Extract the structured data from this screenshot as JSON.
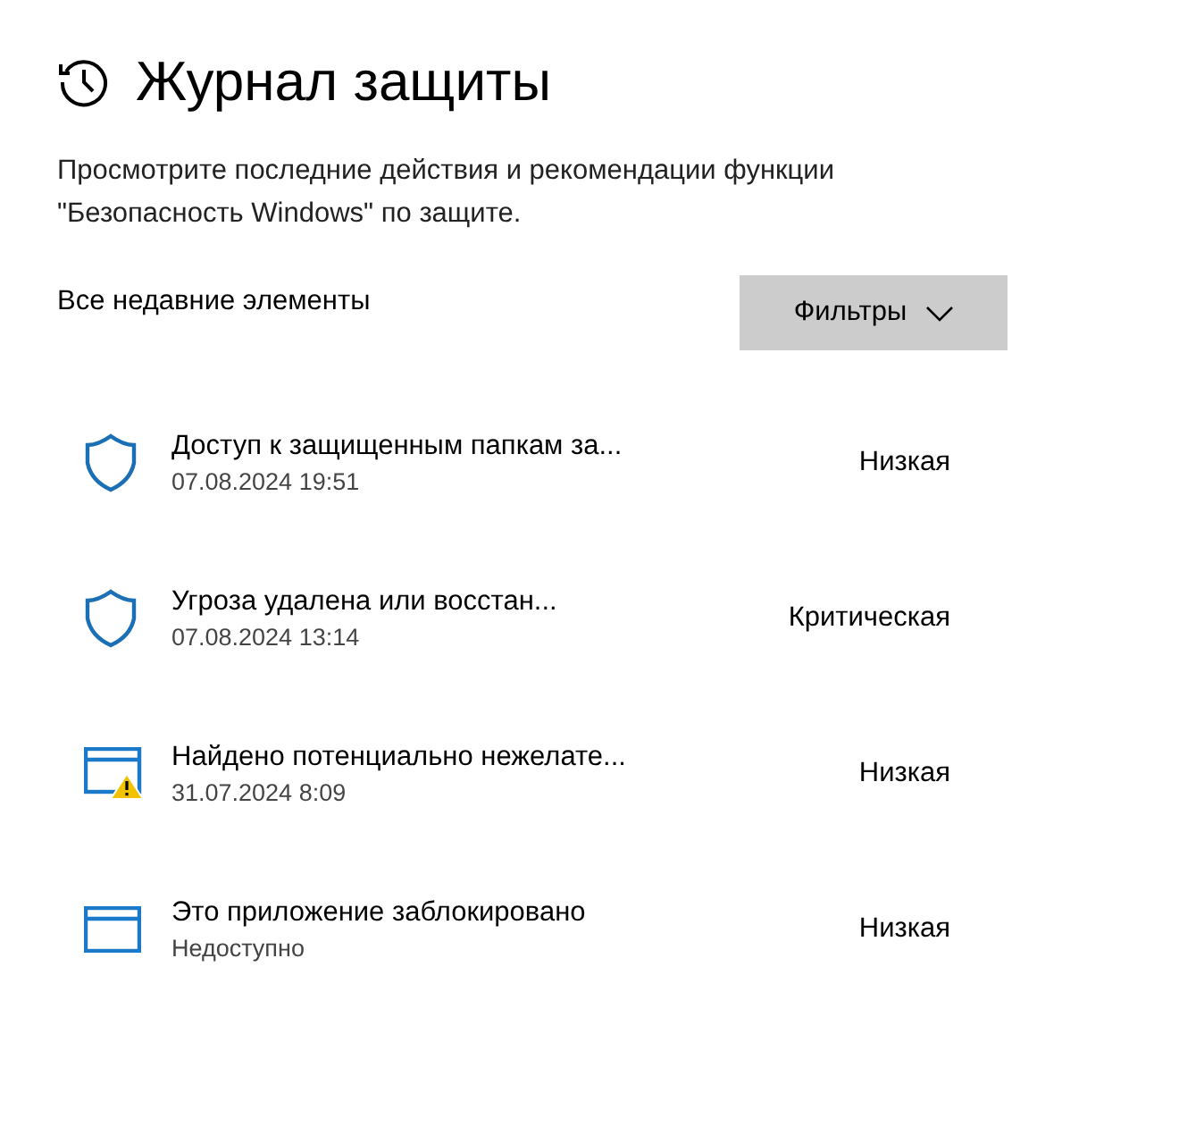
{
  "page": {
    "title": "Журнал защиты",
    "description": "Просмотрите последние действия и рекомендации функции \"Безопасность Windows\" по защите."
  },
  "list_header": {
    "label": "Все недавние элементы",
    "filter_button": "Фильтры"
  },
  "items": [
    {
      "kind": "shield",
      "title": "Доступ к защищенным папкам за...",
      "subtitle": "07.08.2024 19:51",
      "severity": "Низкая"
    },
    {
      "kind": "shield",
      "title": "Угроза удалена или восстан...",
      "subtitle": "07.08.2024 13:14",
      "severity": "Критическая"
    },
    {
      "kind": "window-warning",
      "title": "Найдено потенциально нежелате...",
      "subtitle": "31.07.2024 8:09",
      "severity": "Низкая"
    },
    {
      "kind": "window",
      "title": "Это приложение заблокировано",
      "subtitle": "Недоступно",
      "severity": "Низкая"
    }
  ]
}
